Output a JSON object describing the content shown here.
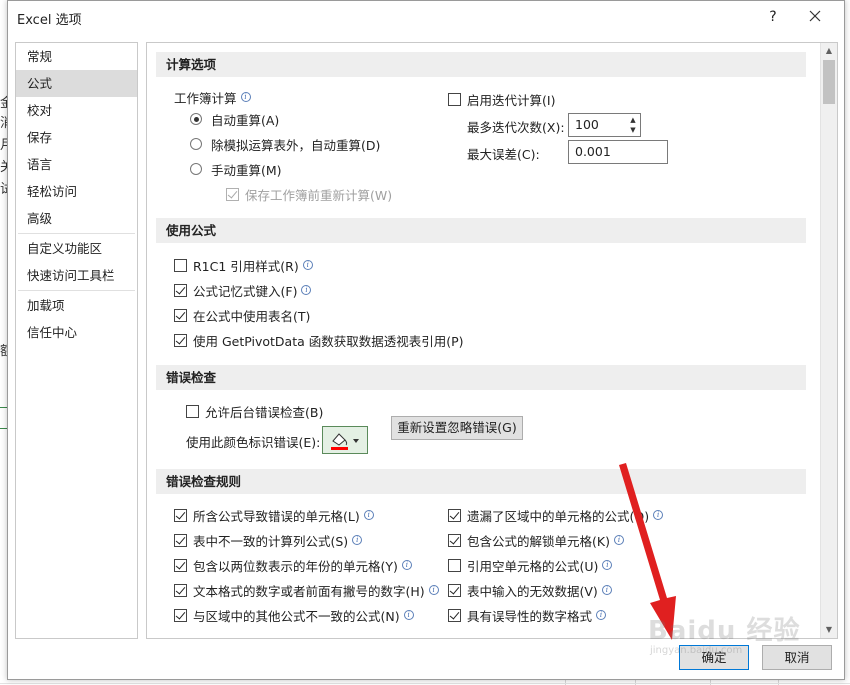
{
  "dialog": {
    "title": "Excel 选项",
    "help_label": "?",
    "ok_label": "确定",
    "cancel_label": "取消"
  },
  "background": {
    "chars": [
      "金",
      "消",
      "月",
      "关",
      "试",
      "额"
    ]
  },
  "sidebar": {
    "items": [
      {
        "label": "常规"
      },
      {
        "label": "公式"
      },
      {
        "label": "校对"
      },
      {
        "label": "保存"
      },
      {
        "label": "语言"
      },
      {
        "label": "轻松访问"
      },
      {
        "label": "高级"
      },
      {
        "label": "自定义功能区"
      },
      {
        "label": "快速访问工具栏"
      },
      {
        "label": "加载项"
      },
      {
        "label": "信任中心"
      }
    ],
    "active": "公式"
  },
  "calc": {
    "header": "计算选项",
    "workbook_label": "工作簿计算",
    "auto": "自动重算(A)",
    "auto_except_tables": "除模拟运算表外，自动重算(D)",
    "manual": "手动重算(M)",
    "recalc_before_save": "保存工作簿前重新计算(W)",
    "iterative": "启用迭代计算(I)",
    "max_iterations_label": "最多迭代次数(X):",
    "max_iterations_value": "100",
    "max_change_label": "最大误差(C):",
    "max_change_value": "0.001"
  },
  "formulas": {
    "header": "使用公式",
    "r1c1": "R1C1 引用样式(R)",
    "autocomplete": "公式记忆式键入(F)",
    "table_names": "在公式中使用表名(T)",
    "getpivotdata": "使用 GetPivotData 函数获取数据透视表引用(P)"
  },
  "error_check": {
    "header": "错误检查",
    "background_check": "允许后台错误检查(B)",
    "color_label": "使用此颜色标识错误(E):",
    "reset_button": "重新设置忽略错误(G)",
    "indicator_color": "#ff0000"
  },
  "rules": {
    "header": "错误检查规则",
    "left": [
      "所含公式导致错误的单元格(L)",
      "表中不一致的计算列公式(S)",
      "包含以两位数表示的年份的单元格(Y)",
      "文本格式的数字或者前面有撇号的数字(H)",
      "与区域中的其他公式不一致的公式(N)"
    ],
    "right": [
      "遗漏了区域中的单元格的公式(O)",
      "包含公式的解锁单元格(K)",
      "引用空单元格的公式(U)",
      "表中输入的无效数据(V)",
      "具有误导性的数字格式"
    ]
  },
  "watermark": {
    "text": "Baidu 经验",
    "sub": "jingyan.baidu.com"
  }
}
